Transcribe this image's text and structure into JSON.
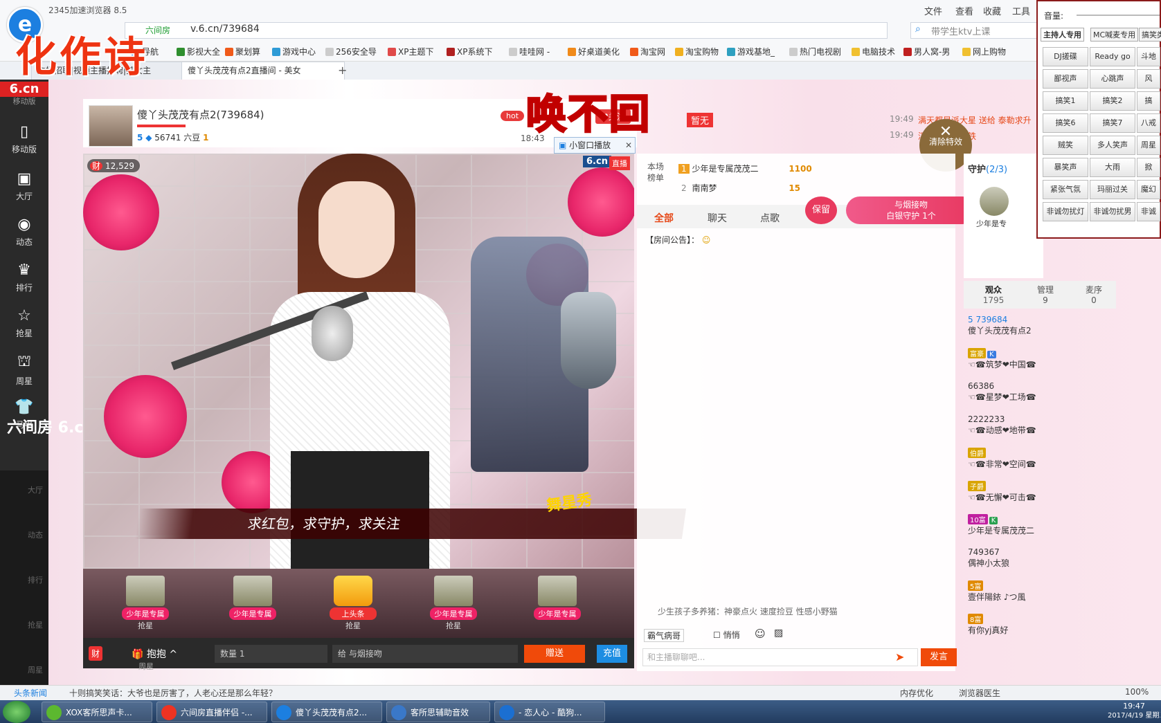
{
  "browser": {
    "title": "2345加速浏览器 8.5",
    "menu": [
      "文件",
      "查看",
      "收藏",
      "工具"
    ],
    "url_prefix": "六间房",
    "url": "v.6.cn/739684",
    "search_placeholder": "带学生ktv上课",
    "calligraphy": "化作诗",
    "bookmarks": [
      "导航",
      "影视大全",
      "聚划算",
      "游戏中心",
      "256安全导",
      "XP主题下",
      "XP系统下",
      "哇哇网 -",
      "好桌道美化",
      "淘宝网",
      "淘宝购物",
      "游戏基地_",
      "热门电视剧",
      "电脑技术",
      "男人窝-男",
      "网上购物"
    ],
    "tabs": [
      {
        "label": "主播招聘|视频主播招聘|美女主"
      },
      {
        "label": "傻丫头茂茂有点2直播间 - 美女"
      }
    ]
  },
  "nav": {
    "logo": "6.cn",
    "top_label": "移动版",
    "items": [
      {
        "label": "移动版",
        "icon": "mobile-icon"
      },
      {
        "label": "大厅",
        "icon": "tv-icon"
      },
      {
        "label": "动态",
        "icon": "compass-icon"
      },
      {
        "label": "排行",
        "icon": "crown-icon"
      },
      {
        "label": "抢星",
        "icon": "star-icon"
      },
      {
        "label": "周星",
        "icon": "gift-icon"
      },
      {
        "label": "马甲",
        "icon": "shirt-icon"
      }
    ],
    "float_brand": "六间房 6.cn",
    "faded_items": [
      "移动版",
      "大厅",
      "动态",
      "排行",
      "抢星",
      "周星"
    ]
  },
  "anchor": {
    "name": "傻丫头茂茂有点2(739684)",
    "level": "5",
    "beans": "56741 六豆",
    "rank_badge": "1",
    "hot": "hot",
    "overlay_title": "唤不回",
    "time": "18:43",
    "mini_play": "小窗口播放",
    "follow": "关注",
    "views": "12,529",
    "brand": "6.cn",
    "live": "直播",
    "caption": "求红包，求守护，求关注",
    "temp_none": "暂无"
  },
  "seats": [
    {
      "label": "少年是专属",
      "cap": "抢星"
    },
    {
      "label": "少年是专属",
      "cap": ""
    },
    {
      "label": "上头条",
      "cap": "抢星"
    },
    {
      "label": "少年是专属",
      "cap": "抢星"
    },
    {
      "label": "少年是专属",
      "cap": ""
    }
  ],
  "bottom": {
    "hug": "抱抱",
    "qty_label": "数量",
    "qty_value": "1",
    "to_label": "给",
    "to_value": "与烟接吻",
    "send": "赠送",
    "recharge": "充值",
    "week_star": "周星"
  },
  "ranking": {
    "label": "本场榜单",
    "rows": [
      {
        "rank": "1",
        "name": "少年是专属茂茂二",
        "amount": "1100"
      },
      {
        "rank": "2",
        "name": "南南梦",
        "amount": "15"
      }
    ]
  },
  "chat": {
    "tabs": [
      "全部",
      "聊天",
      "点歌"
    ],
    "keep": "保留",
    "guard_line1": "与烟接吻",
    "guard_line2": "白银守护 1个",
    "announcement": "【房间公告】：",
    "gift_note": "少生孩子多养猪：神豪点火 速度捡豆 性感小野猫",
    "toolbar_name": "霸气病哥",
    "whisper": "悄悄",
    "input_placeholder": "和主播聊聊吧...",
    "say": "发言",
    "notice_time1": "19:49",
    "notice_time2": "19:49",
    "notice1": "满天都是派大星 送给 泰勒求升",
    "notice2": "溪《碧云香》铁",
    "clear_fx": "清除特效"
  },
  "guard": {
    "label": "守护",
    "count": "(2/3)",
    "first": "少年是专"
  },
  "audience": {
    "tabs": [
      {
        "label": "观众",
        "count": "1795"
      },
      {
        "label": "管理",
        "count": "9"
      },
      {
        "label": "麦序",
        "count": "0"
      }
    ],
    "items": [
      {
        "line1": "5 739684",
        "line2": "傻丫头茂茂有点2"
      },
      {
        "line1": "☜☎筑梦❤中国☎",
        "line2": ""
      },
      {
        "line1": "66386",
        "line2": "☜☎星梦❤工场☎"
      },
      {
        "line1": "2222233",
        "line2": "☜☎动感❤地带☎"
      },
      {
        "line1": "☜☎非常❤空间☎",
        "line2": ""
      },
      {
        "line1": "☜☎无懈❤可击☎",
        "line2": ""
      },
      {
        "line1": "少年是专属茂茂二",
        "line2": ""
      },
      {
        "line1": "749367",
        "line2": "偶神小太狼"
      },
      {
        "line1": "壹伴陽銥 ♪つ風",
        "line2": ""
      },
      {
        "line1": "有你yj真好",
        "line2": ""
      }
    ]
  },
  "sound_panel": {
    "volume_label": "音量:",
    "tabs": [
      "主持人专用",
      "MC喊麦专用",
      "搞笑类"
    ],
    "buttons": [
      "DJ搓碟",
      "Ready go",
      "斗地",
      "鄙视声",
      "心跳声",
      "风",
      "搞笑1",
      "搞笑2",
      "搞",
      "搞笑6",
      "搞笑7",
      "八戒",
      "贼笑",
      "多人笑声",
      "周星",
      "暴笑声",
      "大雨",
      "掀",
      "紧张气氛",
      "玛丽过关",
      "魔幻",
      "非诚勿扰灯",
      "非诚勿扰男",
      "非诚"
    ]
  },
  "status": {
    "news": "头条新闻",
    "ticker": "十则搞笑笑话：大爷也是厉害了，人老心还是那么年轻？",
    "memory": "内存优化",
    "doctor": "浏览器医生",
    "zoom": "100%"
  },
  "taskbar": {
    "tasks": [
      {
        "label": "XOX客所思声卡...",
        "color": "#5cb82f"
      },
      {
        "label": "六间房直播伴侣 -...",
        "color": "#e32"
      },
      {
        "label": "傻丫头茂茂有点2...",
        "color": "#1c7fe0"
      },
      {
        "label": "客所思辅助音效",
        "color": "#3a78c8"
      },
      {
        "label": "- 恋人心 - 酷狗...",
        "color": "#1b6fd1"
      }
    ],
    "time": "19:47",
    "date": "2017/4/19 星期三"
  }
}
